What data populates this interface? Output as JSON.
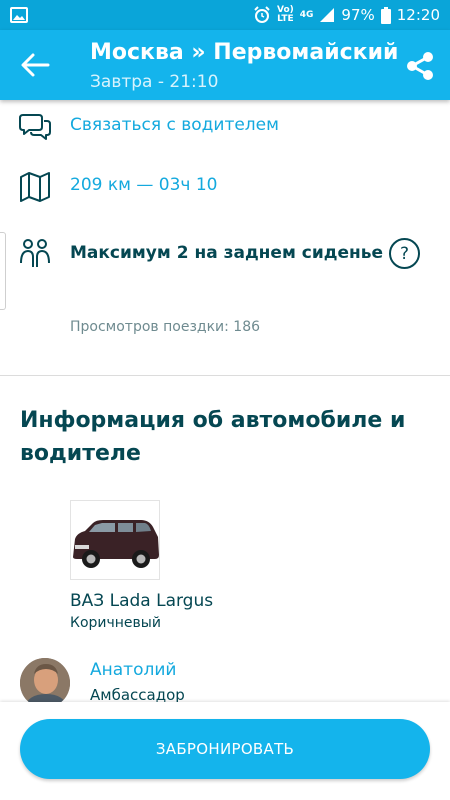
{
  "status_bar": {
    "network_top": "Vo)",
    "network_bottom": "LTE",
    "net_type": "4G",
    "battery": "97%",
    "time": "12:20"
  },
  "header": {
    "title": "Москва » Первомайский",
    "subtitle": "Завтра - 21:10"
  },
  "details": {
    "contact_label": "Связаться с водителем",
    "distance_label": "209 км — 03ч 10",
    "seats_label": "Максимум 2 на заднем сиденье",
    "help_symbol": "?",
    "views_label": "Просмотров поездки: 186"
  },
  "car_section": {
    "title": "Информация об автомобиле и водителе",
    "car_name": "ВАЗ Lada Largus",
    "car_color": "Коричневый"
  },
  "driver": {
    "name": "Анатолий",
    "level": "Амбассадор"
  },
  "actions": {
    "book_label": "ЗАБРОНИРОВАТЬ"
  },
  "colors": {
    "accent": "#14b4ec",
    "status_bar": "#0aa5d9",
    "dark_text": "#054752",
    "link": "#14a9de"
  },
  "icons": [
    "image-icon",
    "alarm-icon",
    "signal-icon",
    "battery-icon",
    "back-arrow-icon",
    "share-icon",
    "chat-bubbles-icon",
    "map-icon",
    "passengers-icon",
    "help-icon"
  ]
}
